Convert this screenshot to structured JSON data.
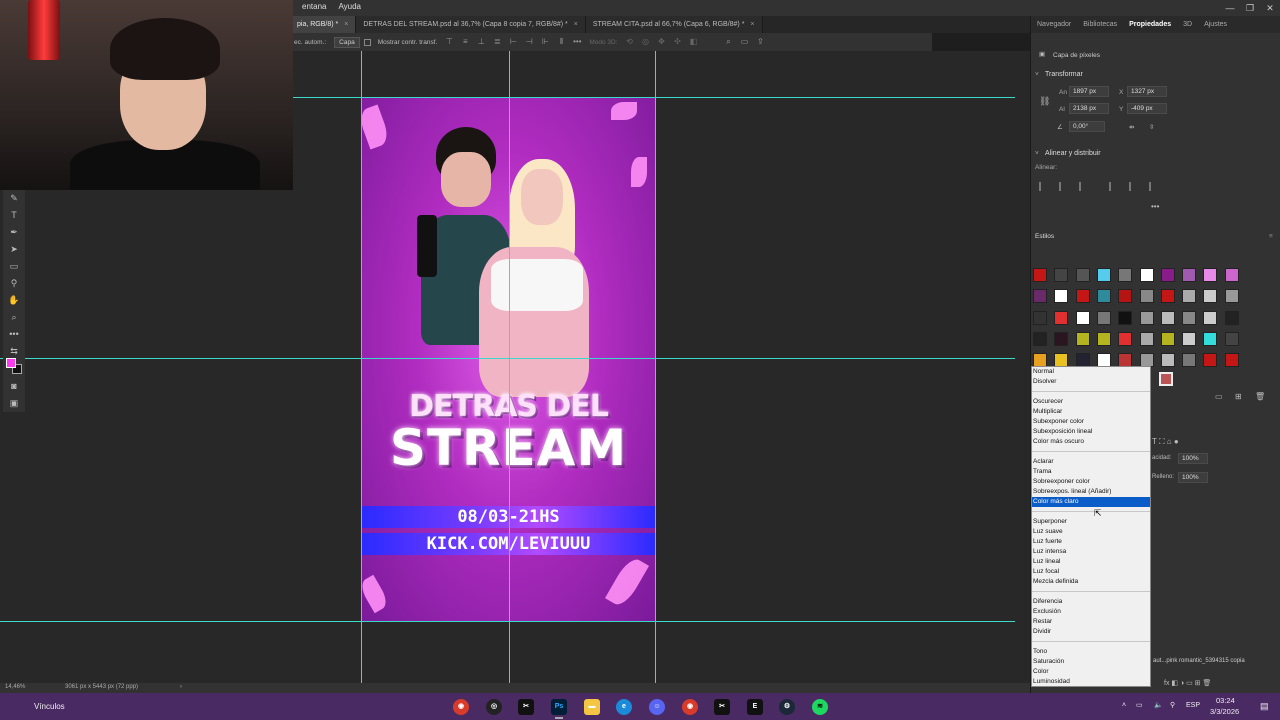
{
  "menubar": {
    "items": [
      "entana",
      "Ayuda"
    ]
  },
  "tabs": [
    {
      "label": "pia, RGB/8) *",
      "active": true
    },
    {
      "label": "DETRAS DEL STREAM.psd al 36,7% (Capa 8 copia 7, RGB/8#) *",
      "active": false
    },
    {
      "label": "STREAM CITA.psd al 66,7% (Capa 6, RGB/8#) *",
      "active": false
    }
  ],
  "options": {
    "auto_select_label": "ec. autom.:",
    "auto_select_value": "Capa",
    "show_transform": "Mostrar contr. transf.",
    "mode3d": "Modo 3D:"
  },
  "poster": {
    "title_small": "DETRAS DEL",
    "title_big": "STREAM",
    "date": "08/03-21HS",
    "url": "KICK.COM/LEVIUUU"
  },
  "status": {
    "zoom": "14,46%",
    "doc_size": "3061 px x 5443 px (72 ppp)"
  },
  "panel": {
    "tabs": [
      "Navegador",
      "Bibliotecas",
      "Propiedades",
      "3D",
      "Ajustes"
    ],
    "layer_type": "Capa de píxeles",
    "transform_title": "Transformar",
    "width_label": "An",
    "width_value": "1897 px",
    "x_label": "X",
    "x_value": "1327 px",
    "height_label": "Al",
    "height_value": "2138 px",
    "y_label": "Y",
    "y_value": "-409 px",
    "angle_value": "0,00°",
    "align_title": "Alinear y distribuir",
    "align_label": "Alinear:",
    "styles_title": "Estilos"
  },
  "blend_modes": [
    [
      "Normal",
      "Disolver"
    ],
    [
      "Oscurecer",
      "Multiplicar",
      "Subexponer color",
      "Subexposición lineal",
      "Color más oscuro"
    ],
    [
      "Aclarar",
      "Trama",
      "Sobreexponer color",
      "Sobreexpos. lineal (Añadir)",
      "Color más claro"
    ],
    [
      "Superponer",
      "Luz suave",
      "Luz fuerte",
      "Luz intensa",
      "Luz lineal",
      "Luz focal",
      "Mezcla definida"
    ],
    [
      "Diferencia",
      "Exclusión",
      "Restar",
      "Dividir"
    ],
    [
      "Tono",
      "Saturación",
      "Color",
      "Luminosidad"
    ]
  ],
  "blend_selected": "Color más claro",
  "layers": {
    "opacity_label": "acidad:",
    "opacity_value": "100%",
    "fill_label": "Relleno:",
    "fill_value": "100%",
    "layer_name": "aut...pink romantic_5394315 copia"
  },
  "taskbar": {
    "left_label": "Vínculos",
    "lang": "ESP",
    "time": "03:24",
    "date": "3/3/2026"
  },
  "colors": {
    "guide": "#3ad9c9",
    "accent_selection": "#0a5cc8",
    "taskbar": "#4a2a63",
    "foreground_swatch": "#ff3bf0"
  }
}
